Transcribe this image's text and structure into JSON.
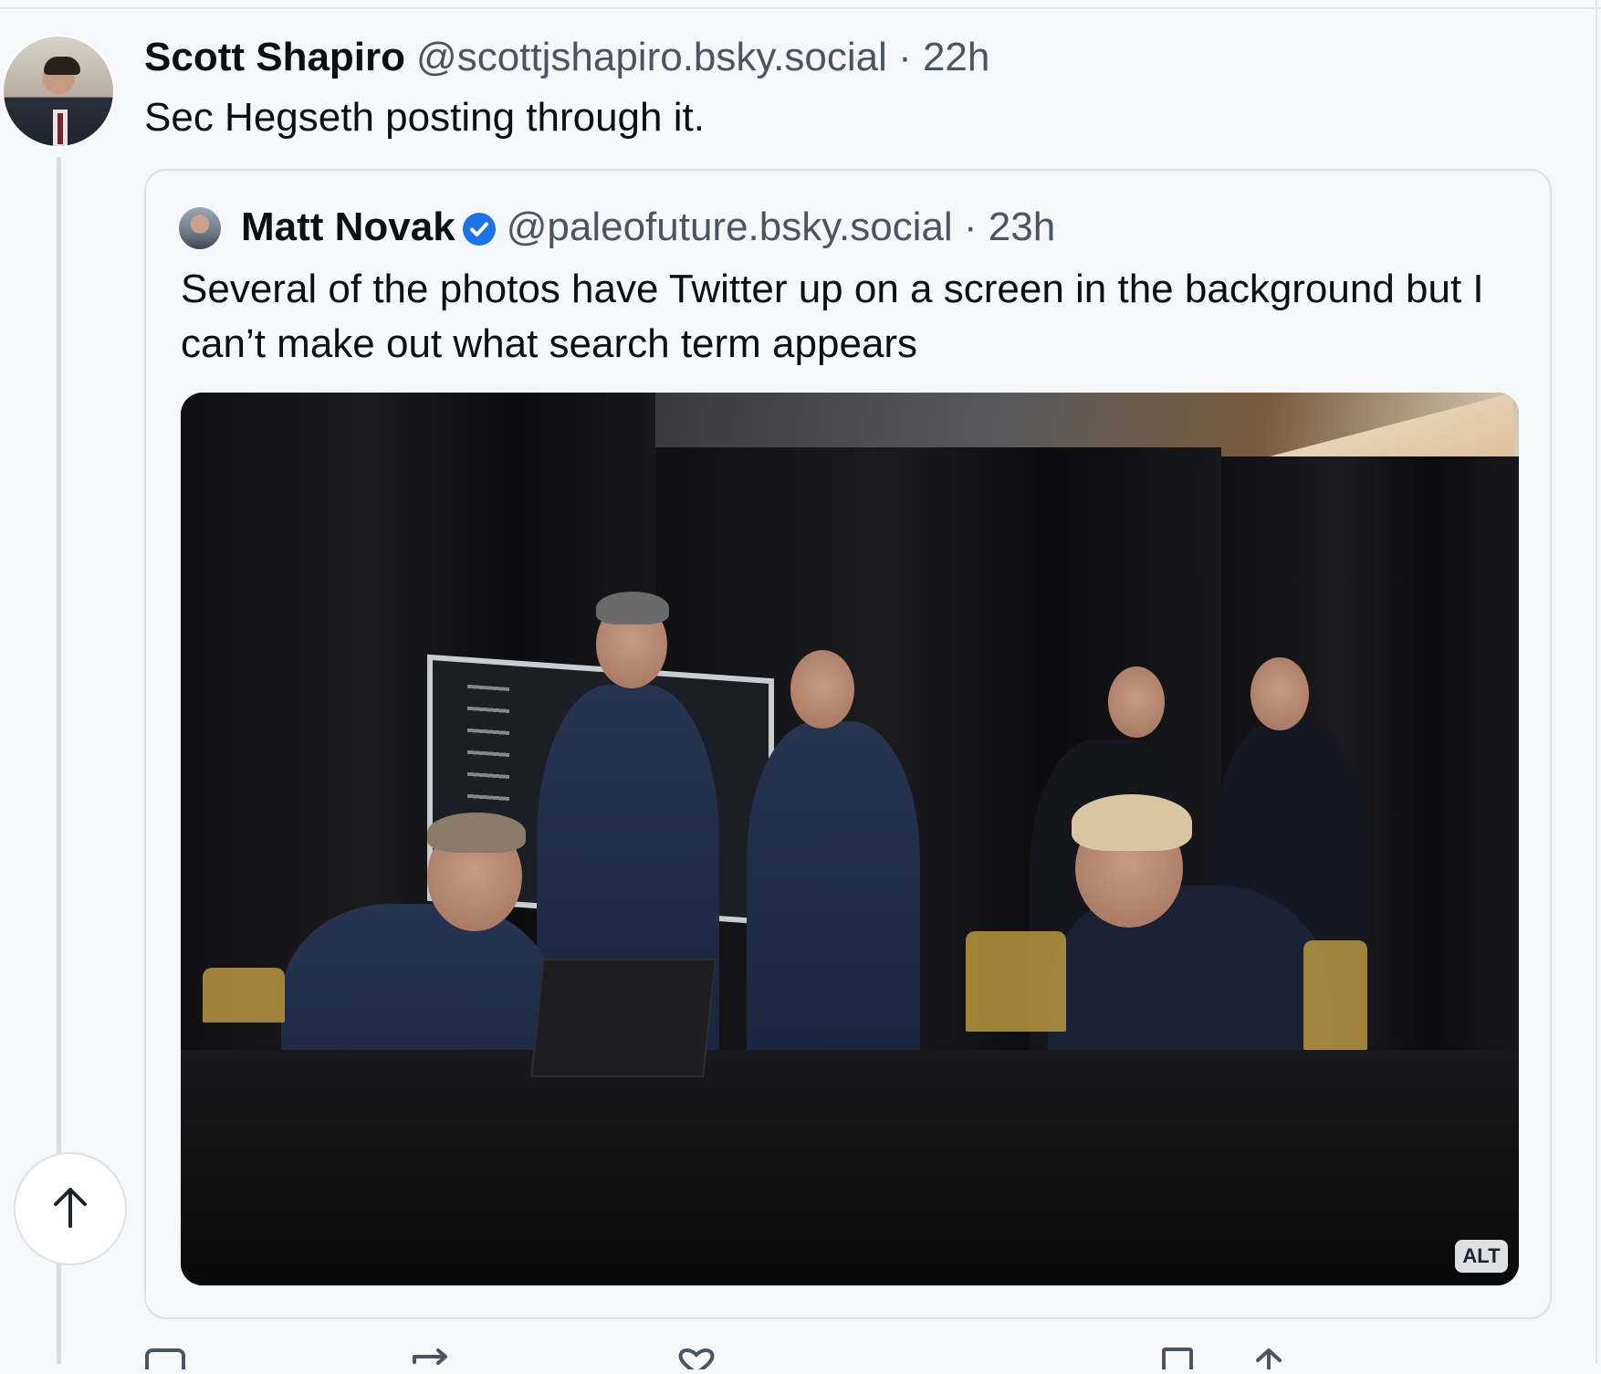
{
  "post": {
    "author_name": "Scott Shapiro",
    "author_handle": "@scottjshapiro.bsky.social · 22h",
    "text": "Sec Hegseth posting through it."
  },
  "quote": {
    "author_name": "Matt Novak",
    "author_handle": "@paleofuture.bsky.social · 23h",
    "verified": true,
    "text": "Several of the photos have Twitter up on a screen in the background but I can’t make out what search term appears",
    "image": {
      "alt_label": "ALT",
      "icon": "photo-image"
    }
  },
  "actions": {
    "reply_icon": "reply-icon",
    "repost_icon": "repost-icon",
    "like_icon": "heart-icon",
    "bookmark_icon": "bookmark-icon",
    "share_icon": "share-icon"
  },
  "scroll_top": {
    "icon": "arrow-up-icon"
  },
  "colors": {
    "background": "#f6f7f9",
    "text_primary": "#0b0f14",
    "text_secondary": "#4a5563",
    "verified": "#1a73e8",
    "border": "#dde1e7"
  }
}
